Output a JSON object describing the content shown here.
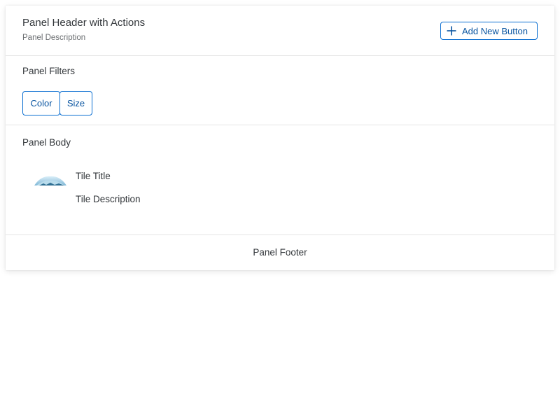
{
  "header": {
    "title": "Panel Header with Actions",
    "description": "Panel Description",
    "add_button_label": "Add New Button",
    "add_button_icon": "add-icon"
  },
  "filters": {
    "title": "Panel Filters",
    "buttons": [
      "Color",
      "Size"
    ]
  },
  "body": {
    "title": "Panel Body",
    "tile": {
      "title": "Tile Title",
      "description": "Tile Description",
      "image": "cloud-landscape-image"
    }
  },
  "footer": {
    "text": "Panel Footer"
  },
  "colors": {
    "accent": "#0a6ed1",
    "accent_text": "#0854a0",
    "text": "#32363a",
    "muted_text": "#6a6d70",
    "divider": "#e5e5e5"
  }
}
